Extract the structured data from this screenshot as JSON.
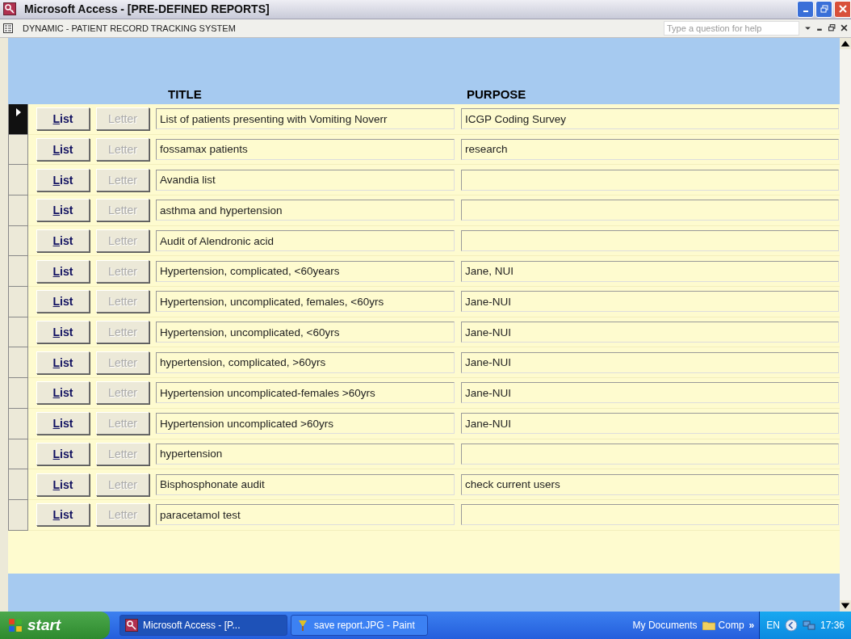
{
  "window": {
    "title": "Microsoft Access - [PRE-DEFINED REPORTS]"
  },
  "document_bar": {
    "title": "DYNAMIC - PATIENT RECORD TRACKING SYSTEM",
    "help": {
      "placeholder": "Type a question for help"
    }
  },
  "form": {
    "columns": [
      "TITLE",
      "PURPOSE"
    ],
    "rows": [
      {
        "selected": true,
        "list_label": "List",
        "letter_label": "Letter",
        "letter_disabled": true,
        "title": "List of patients presenting with Vomiting Noverr",
        "purpose": "ICGP Coding Survey"
      },
      {
        "selected": false,
        "list_label": "List",
        "letter_label": "Letter",
        "letter_disabled": true,
        "title": "fossamax patients",
        "purpose": "research"
      },
      {
        "selected": false,
        "list_label": "List",
        "letter_label": "Letter",
        "letter_disabled": true,
        "title": "Avandia list",
        "purpose": ""
      },
      {
        "selected": false,
        "list_label": "List",
        "letter_label": "Letter",
        "letter_disabled": true,
        "title": "asthma and hypertension",
        "purpose": ""
      },
      {
        "selected": false,
        "list_label": "List",
        "letter_label": "Letter",
        "letter_disabled": true,
        "title": "Audit of Alendronic acid",
        "purpose": ""
      },
      {
        "selected": false,
        "list_label": "List",
        "letter_label": "Letter",
        "letter_disabled": true,
        "title": "Hypertension, complicated, <60years",
        "purpose": "Jane, NUI"
      },
      {
        "selected": false,
        "list_label": "List",
        "letter_label": "Letter",
        "letter_disabled": true,
        "title": "Hypertension, uncomplicated, females, <60yrs",
        "purpose": "Jane-NUI"
      },
      {
        "selected": false,
        "list_label": "List",
        "letter_label": "Letter",
        "letter_disabled": true,
        "title": "Hypertension, uncomplicated, <60yrs",
        "purpose": "Jane-NUI"
      },
      {
        "selected": false,
        "list_label": "List",
        "letter_label": "Letter",
        "letter_disabled": true,
        "title": "hypertension, complicated, >60yrs",
        "purpose": "Jane-NUI"
      },
      {
        "selected": false,
        "list_label": "List",
        "letter_label": "Letter",
        "letter_disabled": true,
        "title": "Hypertension uncomplicated-females >60yrs",
        "purpose": "Jane-NUI"
      },
      {
        "selected": false,
        "list_label": "List",
        "letter_label": "Letter",
        "letter_disabled": true,
        "title": "Hypertension uncomplicated >60yrs",
        "purpose": "Jane-NUI"
      },
      {
        "selected": false,
        "list_label": "List",
        "letter_label": "Letter",
        "letter_disabled": true,
        "title": "hypertension",
        "purpose": ""
      },
      {
        "selected": false,
        "list_label": "List",
        "letter_label": "Letter",
        "letter_disabled": true,
        "title": "Bisphosphonate audit",
        "purpose": "check current users"
      },
      {
        "selected": false,
        "list_label": "List",
        "letter_label": "Letter",
        "letter_disabled": true,
        "title": "paracetamol test",
        "purpose": ""
      }
    ]
  },
  "taskbar": {
    "start": "start",
    "tasks": [
      {
        "label": "Microsoft Access - [P...",
        "selected": true
      },
      {
        "label": "save report.JPG - Paint",
        "selected": false
      }
    ],
    "quick": [
      "My Documents",
      "Comp"
    ],
    "more": "»",
    "language": "EN",
    "clock": "17:36"
  }
}
